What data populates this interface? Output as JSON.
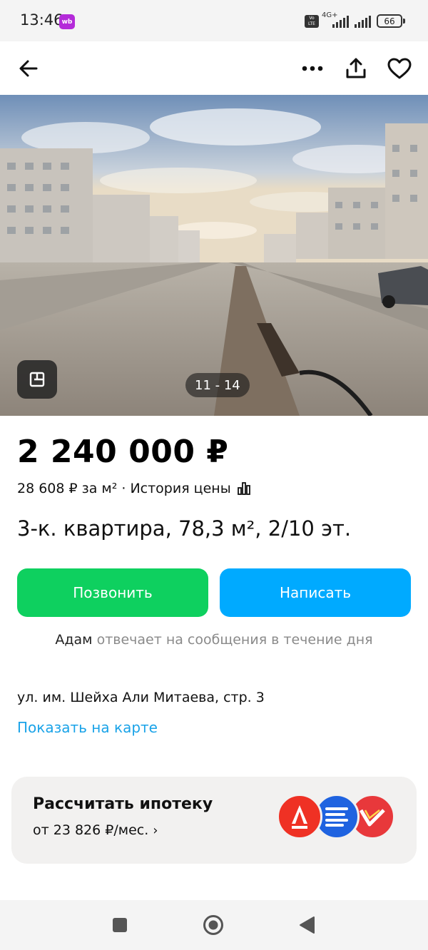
{
  "status_bar": {
    "time": "13:46",
    "app_badge": "wb",
    "volte": "Vo LTE",
    "network": "4G+",
    "battery": "66"
  },
  "toolbar": {
    "back_icon": "arrow-left-icon",
    "more_icon": "more-dots-icon",
    "share_icon": "share-icon",
    "favorite_icon": "heart-icon"
  },
  "gallery": {
    "counter": "11 - 14",
    "plan_icon": "floor-plan-icon"
  },
  "listing": {
    "price": "2 240 000 ₽",
    "price_per_m2": "28 608 ₽ за м²",
    "separator": "·",
    "price_history": "История цены",
    "title": "3-к. квартира, 78,3 м², 2/10 эт."
  },
  "actions": {
    "call_label": "Позвонить",
    "write_label": "Написать"
  },
  "seller": {
    "name": "Адам",
    "response_text": "отвечает на сообщения в течение дня"
  },
  "location": {
    "address": "ул. им. Шейха Али Митаева, стр. 3",
    "map_link": "Показать на карте"
  },
  "mortgage": {
    "title": "Рассчитать ипотеку",
    "from": "от 23 826 ₽/мес.",
    "chevron": "›",
    "banks": [
      "alfa-bank-logo",
      "sber-logo",
      "bank-logo"
    ],
    "colors": {
      "alfa": "#ef3124",
      "sber": "#1f63e0",
      "third": "#e8383b"
    }
  },
  "colors": {
    "call_button": "#0ed05f",
    "write_button": "#00aaff",
    "link": "#1aa3e8"
  },
  "navbar": {
    "recents_icon": "square-icon",
    "home_icon": "circle-home-icon",
    "back_icon": "triangle-back-icon"
  }
}
